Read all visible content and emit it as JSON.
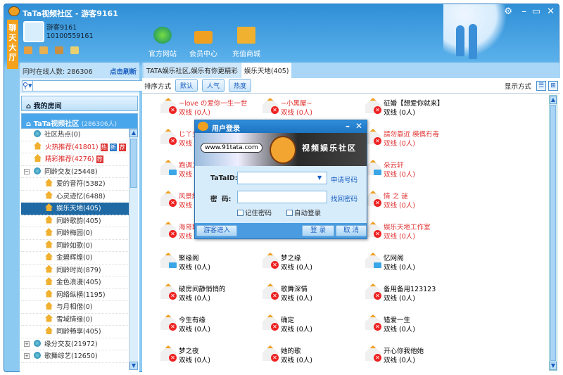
{
  "window": {
    "title": "TaTa视频社区 - 游客9161",
    "controls": [
      "settings",
      "minimize",
      "maximize",
      "close"
    ]
  },
  "side_tab": "聊天大厅",
  "user": {
    "name": "游客9161",
    "id": "10100559161"
  },
  "nav": [
    {
      "label": "官方网站",
      "icon": "globe-icon"
    },
    {
      "label": "会员中心",
      "icon": "crown-icon"
    },
    {
      "label": "充值商城",
      "icon": "bank-icon"
    }
  ],
  "left": {
    "online_label": "同时在线人数: 286306",
    "refresh": "点击刷新",
    "search_button": "搜索",
    "search_value": "",
    "my_room": "我的房间",
    "community": "TaTa视频社区",
    "community_count": "(286306人)",
    "tree": [
      {
        "label": "社区热点(0)",
        "icon": "globe",
        "level": 1
      },
      {
        "label": "火热推荐(41801)",
        "icon": "house",
        "level": 1,
        "red": true,
        "badges": [
          "热",
          "新",
          "荐"
        ]
      },
      {
        "label": "精彩推荐(4276)",
        "icon": "house",
        "level": 1,
        "red": true,
        "badges": [
          "荐"
        ]
      },
      {
        "label": "同龄交友(25448)",
        "icon": "globe",
        "level": 1,
        "expander": "−"
      },
      {
        "label": "爱的音符(5382)",
        "icon": "house",
        "level": 2
      },
      {
        "label": "心灵迹忆(6488)",
        "icon": "house",
        "level": 2
      },
      {
        "label": "娱乐天地(405)",
        "icon": "house",
        "level": 2,
        "selected": true
      },
      {
        "label": "同龄歌韵(405)",
        "icon": "house",
        "level": 2
      },
      {
        "label": "同龄梅园(0)",
        "icon": "house",
        "level": 2
      },
      {
        "label": "同龄如歌(0)",
        "icon": "house",
        "level": 2
      },
      {
        "label": "金碧辉煌(0)",
        "icon": "house",
        "level": 2
      },
      {
        "label": "同龄时尚(879)",
        "icon": "house",
        "level": 2
      },
      {
        "label": "金色浪漫(405)",
        "icon": "house",
        "level": 2
      },
      {
        "label": "网络纵横(1195)",
        "icon": "house",
        "level": 2
      },
      {
        "label": "与月相偕(0)",
        "icon": "house",
        "level": 2
      },
      {
        "label": "雪域情缘(0)",
        "icon": "house",
        "level": 2
      },
      {
        "label": "同龄畅享(405)",
        "icon": "house",
        "level": 2
      },
      {
        "label": "缘分交友(21972)",
        "icon": "globe",
        "level": 1,
        "expander": "+"
      },
      {
        "label": "歌舞综艺(12650)",
        "icon": "globe",
        "level": 1,
        "expander": "+"
      }
    ]
  },
  "main": {
    "tabs": [
      {
        "label": "TATA娱乐社区,娱乐有你更精彩",
        "active": false
      },
      {
        "label": "娱乐天地(405)",
        "active": true
      }
    ],
    "sort_label": "排序方式",
    "sort_buttons": [
      "默认",
      "人气",
      "热度"
    ],
    "display_label": "显示方式",
    "rooms": [
      [
        {
          "name": "~love の爱你一生一世",
          "sub": "双线 (0人)",
          "red": true,
          "status": "x"
        },
        {
          "name": "~小黑屋~",
          "sub": "双线 (0人)",
          "red": true,
          "status": "x"
        },
        {
          "name": "征婚【想爱你就来】",
          "sub": "双线 (0人)",
          "status": "x"
        }
      ],
      [
        {
          "name": "じ丫头",
          "sub": "双线",
          "red": true,
          "status": "x"
        },
        null,
        {
          "name": "請勿靠近 楧儰冇毒",
          "sub": "双线 (0人)",
          "red": true,
          "status": "x"
        }
      ],
      [
        {
          "name": "跑调之",
          "sub": "双线",
          "red": true,
          "status": "blue"
        },
        null,
        {
          "name": "朵云轩",
          "sub": "双线 (0人)",
          "red": true,
          "status": "blue"
        }
      ],
      [
        {
          "name": "风景綫",
          "sub": "双线",
          "red": true,
          "status": "x"
        },
        null,
        {
          "name": "情 之 谜",
          "sub": "双线 (0人)",
          "red": true,
          "status": "x"
        }
      ],
      [
        {
          "name": "海哥聊",
          "sub": "双线",
          "red": true,
          "status": "x"
        },
        null,
        {
          "name": "娱乐天地工作室",
          "sub": "双线 (0人)",
          "red": true,
          "status": "x"
        }
      ],
      [
        {
          "name": "聚缘阁",
          "sub": "双线 (0人)",
          "status": "blue"
        },
        {
          "name": "梦之缘",
          "sub": "双线 (0人)",
          "status": "x"
        },
        {
          "name": "忆网阁",
          "sub": "双线 (0人)",
          "status": "blue"
        }
      ],
      [
        {
          "name": "破房间静悄悄的",
          "sub": "双线 (0人)",
          "status": "x"
        },
        {
          "name": "歌舞深情",
          "sub": "双线 (0人)",
          "status": "x"
        },
        {
          "name": "备用备用123123",
          "sub": "双线 (0人)",
          "status": "x"
        }
      ],
      [
        {
          "name": "今生有缘",
          "sub": "双线 (0人)",
          "status": "x"
        },
        {
          "name": "确定",
          "sub": "双线 (0人)",
          "status": "x"
        },
        {
          "name": "错爱一生",
          "sub": "双线 (0人)",
          "status": "x"
        }
      ],
      [
        {
          "name": "梦之夜",
          "sub": "双线 (0人)",
          "status": "x"
        },
        {
          "name": "她的歌",
          "sub": "双线 (0人)",
          "status": "x"
        },
        {
          "name": "开心你我他她",
          "sub": "双线 (0人)",
          "status": "x"
        }
      ]
    ]
  },
  "login": {
    "title": "用户登录",
    "banner_url": "www.91tata.com",
    "banner_title": "视频娱乐社区",
    "banner_logo": "91TATA",
    "id_label": "TaTaID:",
    "id_value": "",
    "apply_link": "申请号码",
    "pwd_label": "密  码:",
    "pwd_value": "",
    "recover_link": "找回密码",
    "remember": "记住密码",
    "auto_login": "自动登录",
    "guest_button": "游客进入",
    "login_button": "登 录",
    "cancel_button": "取 消"
  }
}
